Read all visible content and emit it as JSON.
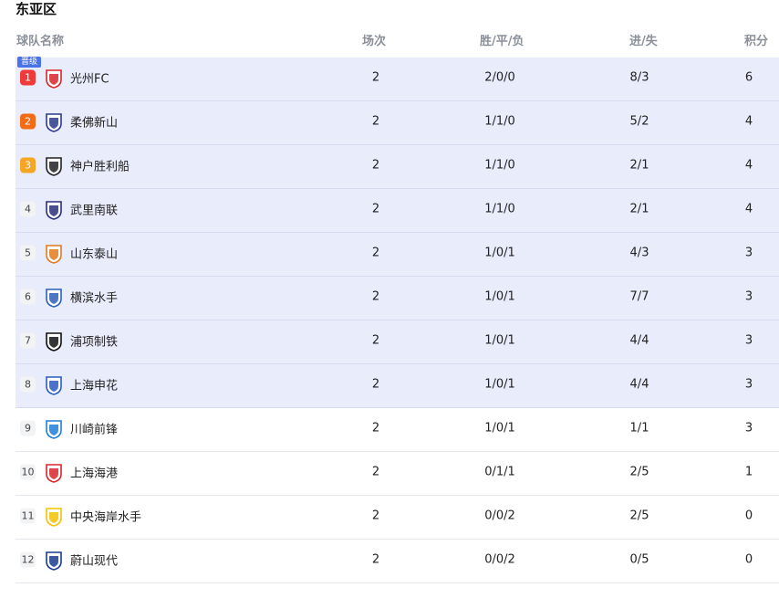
{
  "title": "东亚区",
  "headers": {
    "team": "球队名称",
    "played": "场次",
    "wdl": "胜/平/负",
    "goals": "进/失",
    "points": "积分"
  },
  "promotion_badge": "晋级",
  "colors": {
    "highlight_bg": "#e8ecfb",
    "rank1": "#f03a3a",
    "rank2": "#f36b14",
    "rank3": "#f5a623",
    "promo": "#4a73e8"
  },
  "rows": [
    {
      "rank": "1",
      "team": "光州FC",
      "played": "2",
      "wdl": "2/0/0",
      "goals": "8/3",
      "points": "6",
      "crest": "gwangju-crest-icon"
    },
    {
      "rank": "2",
      "team": "柔佛新山",
      "played": "2",
      "wdl": "1/1/0",
      "goals": "5/2",
      "points": "4",
      "crest": "johor-crest-icon"
    },
    {
      "rank": "3",
      "team": "神户胜利船",
      "played": "2",
      "wdl": "1/1/0",
      "goals": "2/1",
      "points": "4",
      "crest": "kobe-crest-icon"
    },
    {
      "rank": "4",
      "team": "武里南联",
      "played": "2",
      "wdl": "1/1/0",
      "goals": "2/1",
      "points": "4",
      "crest": "buriram-crest-icon"
    },
    {
      "rank": "5",
      "team": "山东泰山",
      "played": "2",
      "wdl": "1/0/1",
      "goals": "4/3",
      "points": "3",
      "crest": "shandong-crest-icon"
    },
    {
      "rank": "6",
      "team": "横滨水手",
      "played": "2",
      "wdl": "1/0/1",
      "goals": "7/7",
      "points": "3",
      "crest": "yokohama-crest-icon"
    },
    {
      "rank": "7",
      "team": "浦项制铁",
      "played": "2",
      "wdl": "1/0/1",
      "goals": "4/4",
      "points": "3",
      "crest": "pohang-crest-icon"
    },
    {
      "rank": "8",
      "team": "上海申花",
      "played": "2",
      "wdl": "1/0/1",
      "goals": "4/4",
      "points": "3",
      "crest": "shenhua-crest-icon"
    },
    {
      "rank": "9",
      "team": "川崎前锋",
      "played": "2",
      "wdl": "1/0/1",
      "goals": "1/1",
      "points": "3",
      "crest": "kawasaki-crest-icon"
    },
    {
      "rank": "10",
      "team": "上海海港",
      "played": "2",
      "wdl": "0/1/1",
      "goals": "2/5",
      "points": "1",
      "crest": "port-crest-icon"
    },
    {
      "rank": "11",
      "team": "中央海岸水手",
      "played": "2",
      "wdl": "0/0/2",
      "goals": "2/5",
      "points": "0",
      "crest": "central-coast-crest-icon"
    },
    {
      "rank": "12",
      "team": "蔚山现代",
      "played": "2",
      "wdl": "0/0/2",
      "goals": "0/5",
      "points": "0",
      "crest": "ulsan-crest-icon"
    }
  ]
}
